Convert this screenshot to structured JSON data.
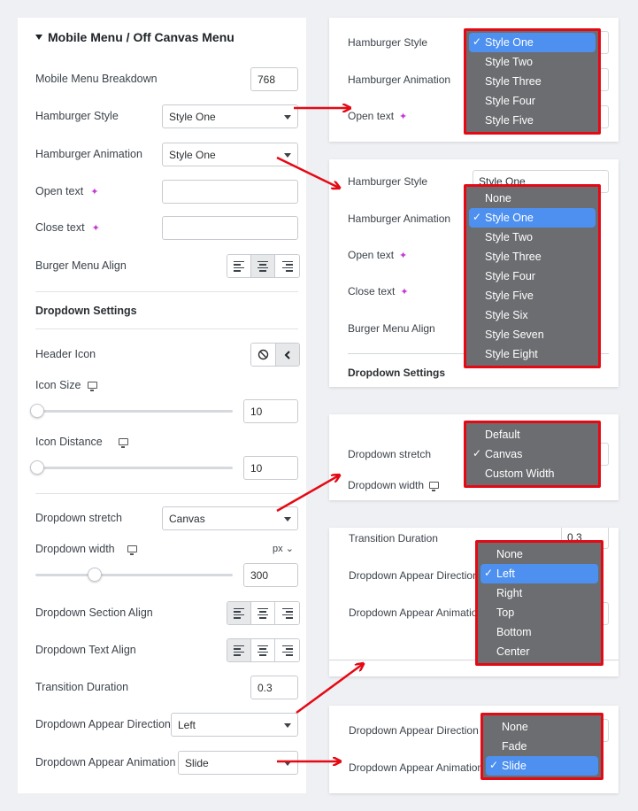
{
  "panel": {
    "title": "Mobile Menu / Off Canvas Menu",
    "mobile_breakdown": {
      "label": "Mobile Menu Breakdown",
      "value": "768"
    },
    "hamburger_style": {
      "label": "Hamburger Style",
      "value": "Style One"
    },
    "hamburger_animation": {
      "label": "Hamburger Animation",
      "value": "Style One"
    },
    "open_text": {
      "label": "Open text",
      "value": ""
    },
    "close_text": {
      "label": "Close text",
      "value": ""
    },
    "burger_align": {
      "label": "Burger Menu Align",
      "active": "center"
    },
    "dropdown_settings": "Dropdown Settings",
    "header_icon": {
      "label": "Header Icon",
      "active": "chevron-left"
    },
    "icon_size": {
      "label": "Icon Size",
      "value": "10"
    },
    "icon_distance": {
      "label": "Icon Distance",
      "value": "10"
    },
    "dropdown_stretch": {
      "label": "Dropdown stretch",
      "value": "Canvas"
    },
    "dropdown_width": {
      "label": "Dropdown width",
      "unit": "px",
      "value": "300"
    },
    "section_align": {
      "label": "Dropdown Section Align",
      "active": "left"
    },
    "text_align": {
      "label": "Dropdown Text Align",
      "active": "left"
    },
    "transition_duration": {
      "label": "Transition Duration",
      "value": "0.3"
    },
    "appear_direction": {
      "label": "Dropdown Appear Direction",
      "value": "Left"
    },
    "appear_animation": {
      "label": "Dropdown Appear Animation",
      "value": "Slide"
    }
  },
  "card1": {
    "labels": [
      "Hamburger Style",
      "Hamburger Animation",
      "Open text"
    ],
    "options": [
      "Style One",
      "Style Two",
      "Style Three",
      "Style Four",
      "Style Five"
    ],
    "selected": "Style One"
  },
  "card2": {
    "labels": [
      "Hamburger Style",
      "Hamburger Animation",
      "Open text",
      "Close text",
      "Burger Menu Align",
      "Dropdown Settings"
    ],
    "behind_value": "Style One",
    "options": [
      "None",
      "Style One",
      "Style Two",
      "Style Three",
      "Style Four",
      "Style Five",
      "Style Six",
      "Style Seven",
      "Style Eight"
    ],
    "selected": "Style One"
  },
  "card3": {
    "labels": [
      "Dropdown stretch",
      "Dropdown width"
    ],
    "options": [
      "Default",
      "Canvas",
      "Custom Width"
    ],
    "selected": "Canvas"
  },
  "card4": {
    "labels": [
      "Transition Duration",
      "Dropdown Appear Direction",
      "Dropdown Appear Animation"
    ],
    "behind_value": "0.3",
    "options": [
      "None",
      "Left",
      "Right",
      "Top",
      "Bottom",
      "Center"
    ],
    "selected": "Left"
  },
  "card5": {
    "labels": [
      "Dropdown Appear Direction",
      "Dropdown Appear Animation"
    ],
    "options": [
      "None",
      "Fade",
      "Slide"
    ],
    "selected": "Slide"
  },
  "colors": {
    "highlight_border": "#e50914",
    "menu_bg": "#6b6d70",
    "selected_bg": "#4d90f0",
    "arrow": "#e50914",
    "sparkle": "#c23cd1"
  }
}
